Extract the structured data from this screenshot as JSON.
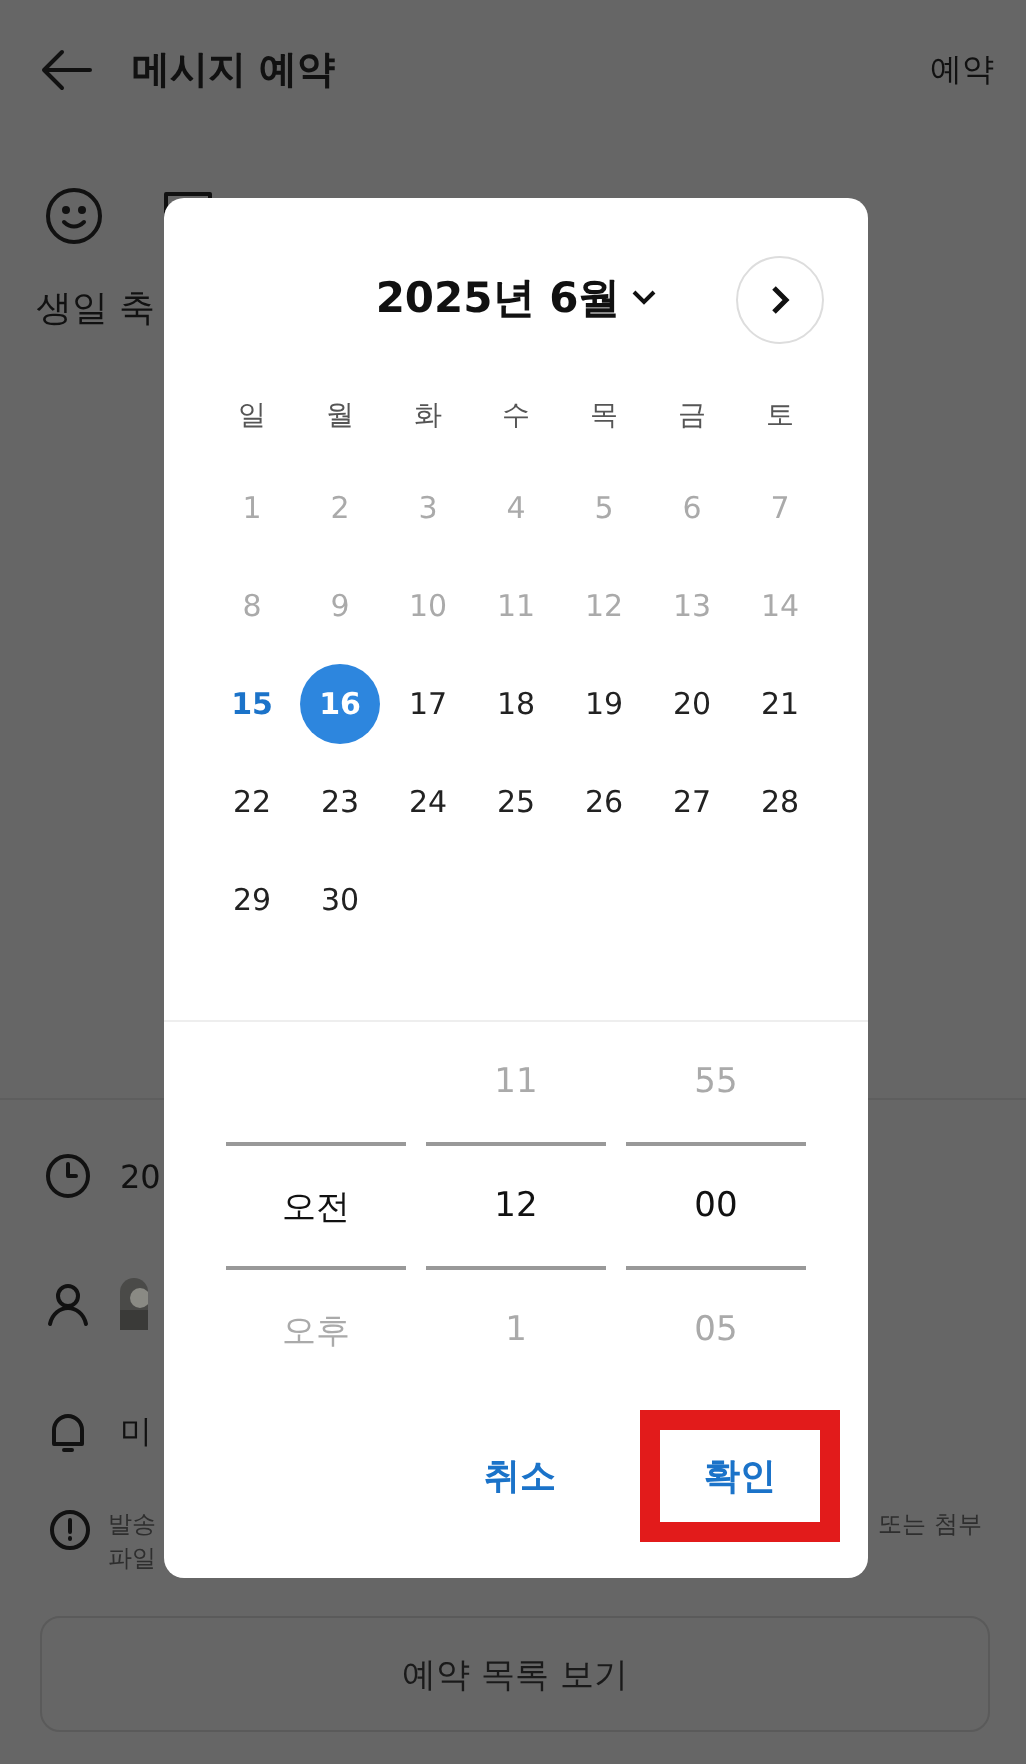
{
  "header": {
    "title": "메시지 예약",
    "action": "예약"
  },
  "message_preview": "생일 축",
  "details": [
    {
      "kind": "time",
      "text": "20"
    },
    {
      "kind": "recipient"
    },
    {
      "kind": "alert",
      "text": "미"
    }
  ],
  "notice": {
    "line_1": "발송",
    "line_2": "파일",
    "tail": "또는 첨부"
  },
  "list_button": "예약 목록 보기",
  "dialog": {
    "month_label": "2025년 6월",
    "weekdays": [
      "일",
      "월",
      "화",
      "수",
      "목",
      "금",
      "토"
    ],
    "days": [
      {
        "label": "1",
        "disabled": true,
        "today": false,
        "selected": false
      },
      {
        "label": "2",
        "disabled": true,
        "today": false,
        "selected": false
      },
      {
        "label": "3",
        "disabled": true,
        "today": false,
        "selected": false
      },
      {
        "label": "4",
        "disabled": true,
        "today": false,
        "selected": false
      },
      {
        "label": "5",
        "disabled": true,
        "today": false,
        "selected": false
      },
      {
        "label": "6",
        "disabled": true,
        "today": false,
        "selected": false
      },
      {
        "label": "7",
        "disabled": true,
        "today": false,
        "selected": false
      },
      {
        "label": "8",
        "disabled": true,
        "today": false,
        "selected": false
      },
      {
        "label": "9",
        "disabled": true,
        "today": false,
        "selected": false
      },
      {
        "label": "10",
        "disabled": true,
        "today": false,
        "selected": false
      },
      {
        "label": "11",
        "disabled": true,
        "today": false,
        "selected": false
      },
      {
        "label": "12",
        "disabled": true,
        "today": false,
        "selected": false
      },
      {
        "label": "13",
        "disabled": true,
        "today": false,
        "selected": false
      },
      {
        "label": "14",
        "disabled": true,
        "today": false,
        "selected": false
      },
      {
        "label": "15",
        "disabled": false,
        "today": true,
        "selected": false
      },
      {
        "label": "16",
        "disabled": false,
        "today": false,
        "selected": true
      },
      {
        "label": "17",
        "disabled": false,
        "today": false,
        "selected": false
      },
      {
        "label": "18",
        "disabled": false,
        "today": false,
        "selected": false
      },
      {
        "label": "19",
        "disabled": false,
        "today": false,
        "selected": false
      },
      {
        "label": "20",
        "disabled": false,
        "today": false,
        "selected": false
      },
      {
        "label": "21",
        "disabled": false,
        "today": false,
        "selected": false
      },
      {
        "label": "22",
        "disabled": false,
        "today": false,
        "selected": false
      },
      {
        "label": "23",
        "disabled": false,
        "today": false,
        "selected": false
      },
      {
        "label": "24",
        "disabled": false,
        "today": false,
        "selected": false
      },
      {
        "label": "25",
        "disabled": false,
        "today": false,
        "selected": false
      },
      {
        "label": "26",
        "disabled": false,
        "today": false,
        "selected": false
      },
      {
        "label": "27",
        "disabled": false,
        "today": false,
        "selected": false
      },
      {
        "label": "28",
        "disabled": false,
        "today": false,
        "selected": false
      },
      {
        "label": "29",
        "disabled": false,
        "today": false,
        "selected": false
      },
      {
        "label": "30",
        "disabled": false,
        "today": false,
        "selected": false
      }
    ],
    "time_columns": [
      {
        "items": [
          {
            "label": "오전",
            "selected": true
          },
          {
            "label": "오후",
            "selected": false
          }
        ]
      },
      {
        "items": [
          {
            "label": "11",
            "selected": false
          },
          {
            "label": "12",
            "selected": true
          },
          {
            "label": "1",
            "selected": false
          }
        ]
      },
      {
        "items": [
          {
            "label": "55",
            "selected": false
          },
          {
            "label": "00",
            "selected": true
          },
          {
            "label": "05",
            "selected": false
          }
        ]
      }
    ],
    "buttons": [
      {
        "label": "취소",
        "highlighted": false
      },
      {
        "label": "확인",
        "highlighted": true
      }
    ]
  }
}
